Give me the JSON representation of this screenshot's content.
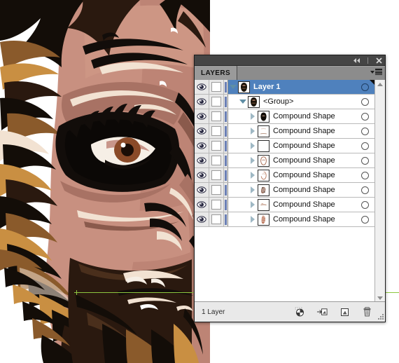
{
  "app": {
    "document_kind": "vector-illustration",
    "artwork_description": "Close-up cartoon vector illustration of a bearded caveman face",
    "artwork_colors": {
      "skin": "#c89080",
      "skin_shadow": "#a87264",
      "skin_deep": "#8a5a4c",
      "hair_dark": "#3a2318",
      "hair_mid": "#8a5a2b",
      "hair_light": "#c98f42",
      "highlight": "#f2e2d2",
      "outline": "#120d0a",
      "eye_iris": "#8a4a28",
      "eye_white": "#f6efe6",
      "background": "#ffffff"
    },
    "smart_guide_color": "#8dc63f"
  },
  "panel": {
    "title_bar": {
      "collapse_button": "collapse-to-icons",
      "close_button": "close"
    },
    "tab": {
      "label": "LAYERS",
      "menu_icon": "panel-menu"
    },
    "footer": {
      "count_label": "1 Layer",
      "buttons": [
        {
          "name": "make-release-clipping-mask",
          "tooltip": "Make/Release Clipping Mask"
        },
        {
          "name": "create-new-sublayer",
          "tooltip": "Create New Sublayer"
        },
        {
          "name": "create-new-layer",
          "tooltip": "Create New Layer"
        },
        {
          "name": "delete-selection",
          "tooltip": "Delete Selection"
        }
      ]
    },
    "scrollbar": {
      "up_arrow": "scroll-up-arrow",
      "down_arrow": "scroll-down-arrow"
    },
    "columns": {
      "visibility": "eye-icon",
      "lock": "lock-toggle",
      "target": "target-circle"
    },
    "rows": [
      {
        "label": "Layer 1",
        "indent": 0,
        "twisty": "down",
        "selected": true,
        "visible": true,
        "locked": false,
        "thumb": "face",
        "target": "targeted"
      },
      {
        "label": "<Group>",
        "indent": 1,
        "twisty": "down",
        "selected": false,
        "visible": true,
        "locked": false,
        "thumb": "face",
        "target": "untargeted"
      },
      {
        "label": "Compound Shape",
        "indent": 2,
        "twisty": "right",
        "selected": false,
        "visible": true,
        "locked": false,
        "thumb": "face-dark",
        "target": "untargeted"
      },
      {
        "label": "Compound Shape",
        "indent": 2,
        "twisty": "right",
        "selected": false,
        "visible": true,
        "locked": false,
        "thumb": "faint",
        "target": "untargeted"
      },
      {
        "label": "Compound Shape",
        "indent": 2,
        "twisty": "right",
        "selected": false,
        "visible": true,
        "locked": false,
        "thumb": "blank",
        "target": "untargeted"
      },
      {
        "label": "Compound Shape",
        "indent": 2,
        "twisty": "right",
        "selected": false,
        "visible": true,
        "locked": false,
        "thumb": "outline",
        "target": "untargeted"
      },
      {
        "label": "Compound Shape",
        "indent": 2,
        "twisty": "right",
        "selected": false,
        "visible": true,
        "locked": false,
        "thumb": "outline2",
        "target": "untargeted"
      },
      {
        "label": "Compound Shape",
        "indent": 2,
        "twisty": "right",
        "selected": false,
        "visible": true,
        "locked": false,
        "thumb": "speckle",
        "target": "untargeted"
      },
      {
        "label": "Compound Shape",
        "indent": 2,
        "twisty": "right",
        "selected": false,
        "visible": true,
        "locked": false,
        "thumb": "thin",
        "target": "untargeted"
      },
      {
        "label": "Compound Shape",
        "indent": 2,
        "twisty": "right",
        "selected": false,
        "visible": true,
        "locked": false,
        "thumb": "pink",
        "target": "untargeted"
      }
    ]
  }
}
